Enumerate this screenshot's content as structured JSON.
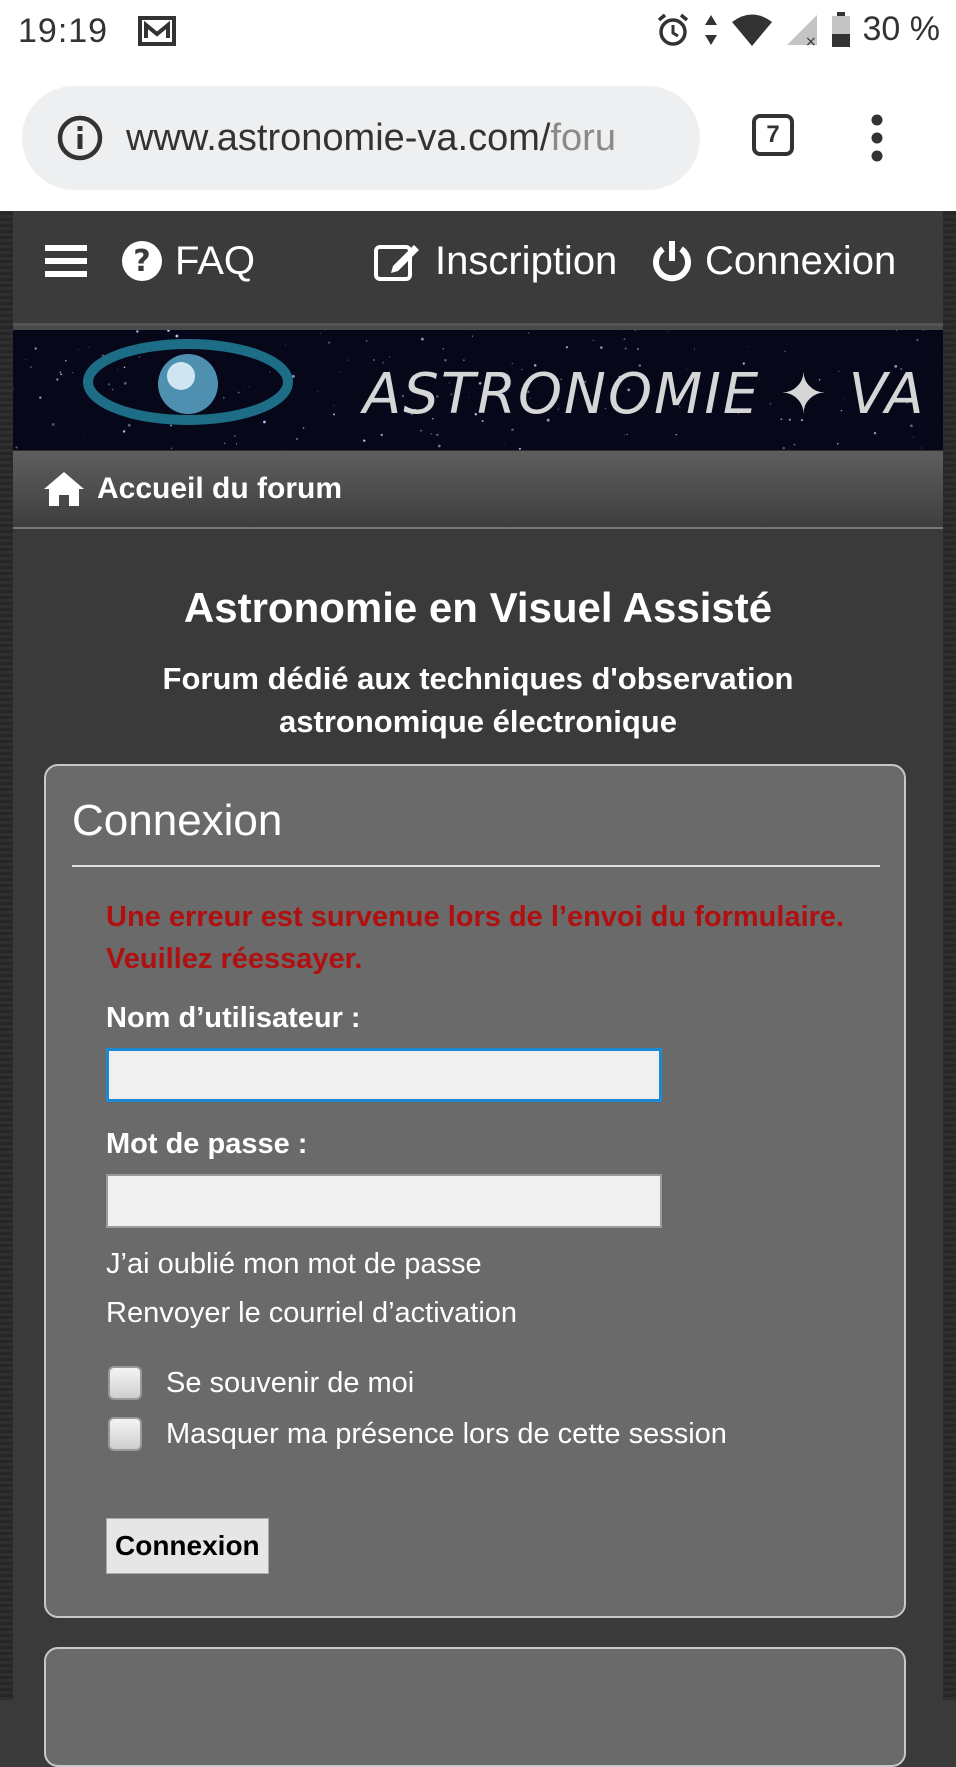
{
  "status_bar": {
    "time": "19:19",
    "battery": "30 %",
    "icons": [
      "mail-icon",
      "alarm-icon",
      "data-arrows-icon",
      "wifi-icon",
      "signal-icon",
      "battery-icon"
    ]
  },
  "browser": {
    "url_main": "www.astronomie-va.com/",
    "url_fade": "foru",
    "tab_count": "7"
  },
  "nav": {
    "faq": "FAQ",
    "inscription": "Inscription",
    "connexion": "Connexion"
  },
  "banner": {
    "logo_text": "ASTRONOMIE ✦ VA"
  },
  "breadcrumb": {
    "home": "Accueil du forum"
  },
  "site": {
    "title": "Astronomie en Visuel Assisté",
    "description": "Forum dédié aux techniques d'observation astronomique électronique"
  },
  "login": {
    "heading": "Connexion",
    "error": "Une erreur est survenue lors de l’envoi du formulaire. Veuillez réessayer.",
    "username_label": "Nom d’utilisateur :",
    "username_value": "",
    "password_label": "Mot de passe :",
    "password_value": "",
    "forgot_password": "J’ai oublié mon mot de passe",
    "resend_activation": "Renvoyer le courriel d’activation",
    "remember_me": "Se souvenir de moi",
    "hide_presence": "Masquer ma présence lors de cette session",
    "submit": "Connexion"
  },
  "colors": {
    "error": "#b01010",
    "focus": "#1e88d0",
    "panel": "#6a6a6a"
  }
}
